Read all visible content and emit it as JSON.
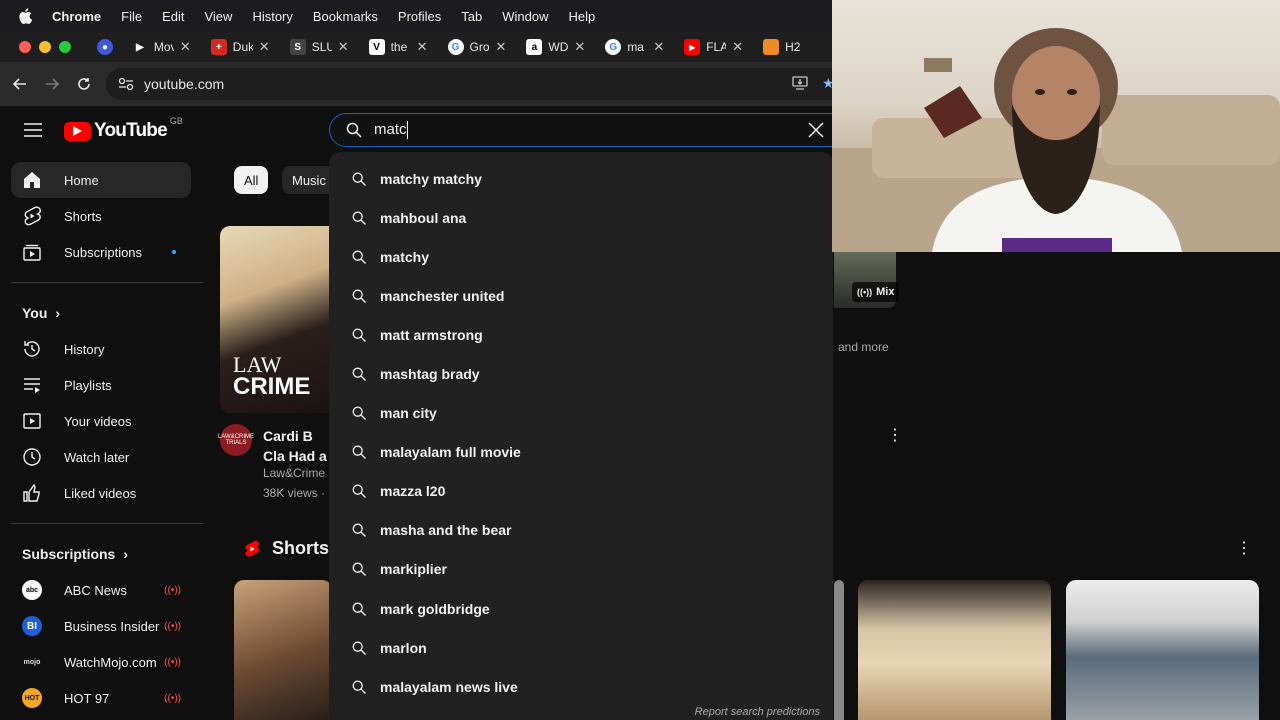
{
  "menubar": {
    "app": "Chrome",
    "items": [
      "File",
      "Edit",
      "View",
      "History",
      "Bookmarks",
      "Profiles",
      "Tab",
      "Window",
      "Help"
    ]
  },
  "tabs": [
    {
      "title": "Mov",
      "favicon": "play-icon",
      "color": "#000000"
    },
    {
      "title": "Duk",
      "favicon": "swiss-flag-icon",
      "color": "#d52b1e"
    },
    {
      "title": "SLU",
      "favicon": "slu-icon",
      "color": "#444444"
    },
    {
      "title": "the",
      "favicon": "v-icon",
      "color": "#ffffff"
    },
    {
      "title": "Gro",
      "favicon": "google-icon",
      "color": "#ffffff"
    },
    {
      "title": "WD",
      "favicon": "amazon-icon",
      "color": "#ffffff"
    },
    {
      "title": "ma",
      "favicon": "google-icon",
      "color": "#ffffff"
    },
    {
      "title": "FLA",
      "favicon": "youtube-icon",
      "color": "#ff0000"
    },
    {
      "title": "H2",
      "favicon": "h2-icon",
      "color": "#f08a24"
    }
  ],
  "address": {
    "url": "youtube.com"
  },
  "youtube": {
    "logo_text": "YouTube",
    "country": "GB",
    "search_query": "matc",
    "chips": [
      "All",
      "Music"
    ],
    "sidebar_main": [
      {
        "label": "Home",
        "icon": "home-icon",
        "active": true
      },
      {
        "label": "Shorts",
        "icon": "shorts-icon"
      },
      {
        "label": "Subscriptions",
        "icon": "subscriptions-icon",
        "dot": true
      }
    ],
    "you_heading": "You",
    "sidebar_you": [
      {
        "label": "History",
        "icon": "history-icon"
      },
      {
        "label": "Playlists",
        "icon": "playlists-icon"
      },
      {
        "label": "Your videos",
        "icon": "your-videos-icon"
      },
      {
        "label": "Watch later",
        "icon": "watch-later-icon"
      },
      {
        "label": "Liked videos",
        "icon": "liked-videos-icon"
      }
    ],
    "subscriptions_heading": "Subscriptions",
    "subscriptions": [
      {
        "label": "ABC News",
        "avatar": "abc",
        "color": "#ffffff"
      },
      {
        "label": "Business Insider",
        "avatar": "BI",
        "color": "#1f5fd6"
      },
      {
        "label": "WatchMojo.com",
        "avatar": "mojo",
        "color": "#0f0f0f"
      },
      {
        "label": "HOT 97",
        "avatar": "HOT",
        "color": "#f5a623"
      }
    ],
    "video": {
      "title": "Cardi B Cla Had a 'Veri",
      "channel": "Law&Crime",
      "views": "38K views ·",
      "thumb_text_1": "LAW",
      "thumb_text_2": "CRIME",
      "avatar_text": "LAW&CRIME TRIALS"
    },
    "right_card": {
      "badge": "Mix",
      "meta": "and more"
    },
    "shorts_heading": "Shorts",
    "suggestions": [
      "matchy matchy",
      "mahboul ana",
      "matchy",
      "manchester united",
      "matt armstrong",
      "mashtag brady",
      "man city",
      "malayalam full movie",
      "mazza l20",
      "masha and the bear",
      "markiplier",
      "mark goldbridge",
      "marlon",
      "malayalam news live"
    ],
    "report_link": "Report search predictions"
  },
  "colors": {
    "accent": "#ff0000",
    "link_blue": "#3ea6ff",
    "background": "#0f0f0f"
  }
}
